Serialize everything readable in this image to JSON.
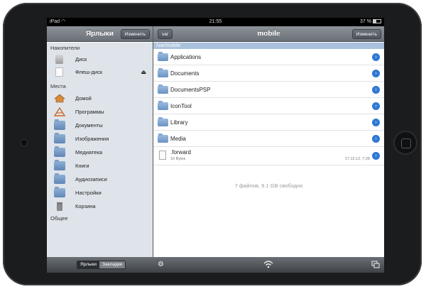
{
  "status": {
    "device": "iPad",
    "wifi_icon": "wifi-icon",
    "time": "21:55",
    "battery": "37 %",
    "battery_fraction": 0.37
  },
  "sidebar": {
    "title": "Ярлыки",
    "edit_label": "Изменить",
    "section_storage": "Накопители",
    "storage": [
      {
        "label": "Диск",
        "icon": "disk-icon"
      },
      {
        "label": "Флеш-диск",
        "icon": "flash-drive-icon",
        "eject": "⏏"
      }
    ],
    "section_places": "Места",
    "places": [
      {
        "label": "Домой",
        "icon": "home-icon"
      },
      {
        "label": "Программы",
        "icon": "apps-icon"
      },
      {
        "label": "Документы",
        "icon": "folder-icon"
      },
      {
        "label": "Изображения",
        "icon": "folder-icon"
      },
      {
        "label": "Медиатека",
        "icon": "folder-icon"
      },
      {
        "label": "Книги",
        "icon": "folder-icon"
      },
      {
        "label": "Аудиозаписи",
        "icon": "folder-icon"
      },
      {
        "label": "Настройки",
        "icon": "folder-icon"
      },
      {
        "label": "Корзина",
        "icon": "trash-icon"
      }
    ],
    "section_shared": "Общее",
    "tabs": [
      "Ярлыки",
      "Закладки"
    ]
  },
  "main": {
    "back_label": "var",
    "title": "mobile",
    "edit_label": "Изменить",
    "path": "/var/mobile",
    "folders": [
      "Applications",
      "Documents",
      "DocumentsPSP",
      "IconTool",
      "Library",
      "Media"
    ],
    "file": {
      "name": ".forward",
      "size": "10 Bytes",
      "date": "17.12.12, 7:28"
    },
    "summary": "7 файлов, 9.1 GB свободно"
  },
  "toolbar": {
    "settings_icon": "⚙",
    "wifi_icon": "wifi-icon",
    "windows_icon": "windows-icon"
  },
  "colors": {
    "accent": "#2e79d3",
    "path_bar": "#a9c1dd",
    "sidebar_bg": "#dfe4ea"
  }
}
